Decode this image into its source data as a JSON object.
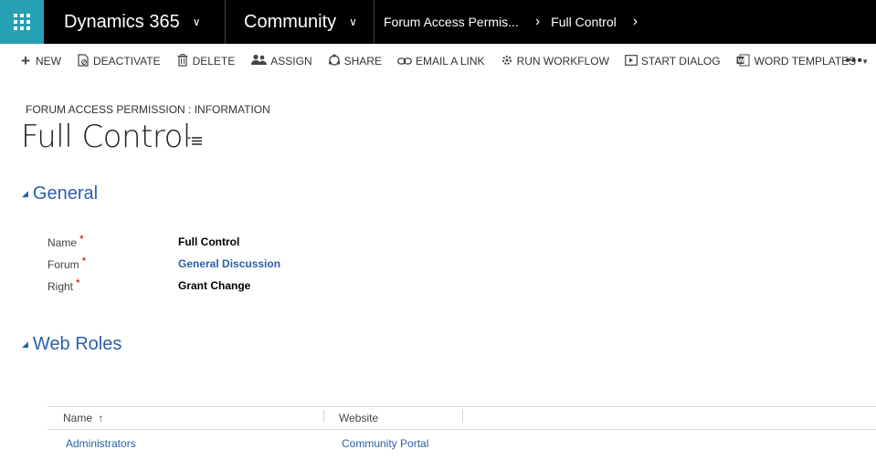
{
  "nav": {
    "app_name": "Dynamics 365",
    "area_name": "Community",
    "breadcrumb_entity": "Forum Access Permis...",
    "breadcrumb_record": "Full Control"
  },
  "commands": {
    "new": "NEW",
    "deactivate": "DEACTIVATE",
    "delete": "DELETE",
    "assign": "ASSIGN",
    "share": "SHARE",
    "email_link": "EMAIL A LINK",
    "run_workflow": "RUN WORKFLOW",
    "start_dialog": "START DIALOG",
    "word_templates": "WORD TEMPLATES",
    "more": "•••"
  },
  "header": {
    "entity_label": "FORUM ACCESS PERMISSION : INFORMATION",
    "title": "Full Control"
  },
  "general": {
    "heading": "General",
    "fields": [
      {
        "label": "Name",
        "value": "Full Control",
        "required": "*"
      },
      {
        "label": "Forum",
        "value": "General Discussion",
        "required": "*"
      },
      {
        "label": "Right",
        "value": "Grant Change",
        "required": "*"
      }
    ]
  },
  "web_roles": {
    "heading": "Web Roles",
    "columns": [
      {
        "label": "Name",
        "sort": "↑"
      },
      {
        "label": "Website"
      }
    ],
    "rows": [
      {
        "name": "Administrators",
        "website": "Community Portal"
      }
    ]
  },
  "colors": {
    "accent": "#26a0b5",
    "link": "#2b60a9",
    "required": "#cc0000"
  }
}
